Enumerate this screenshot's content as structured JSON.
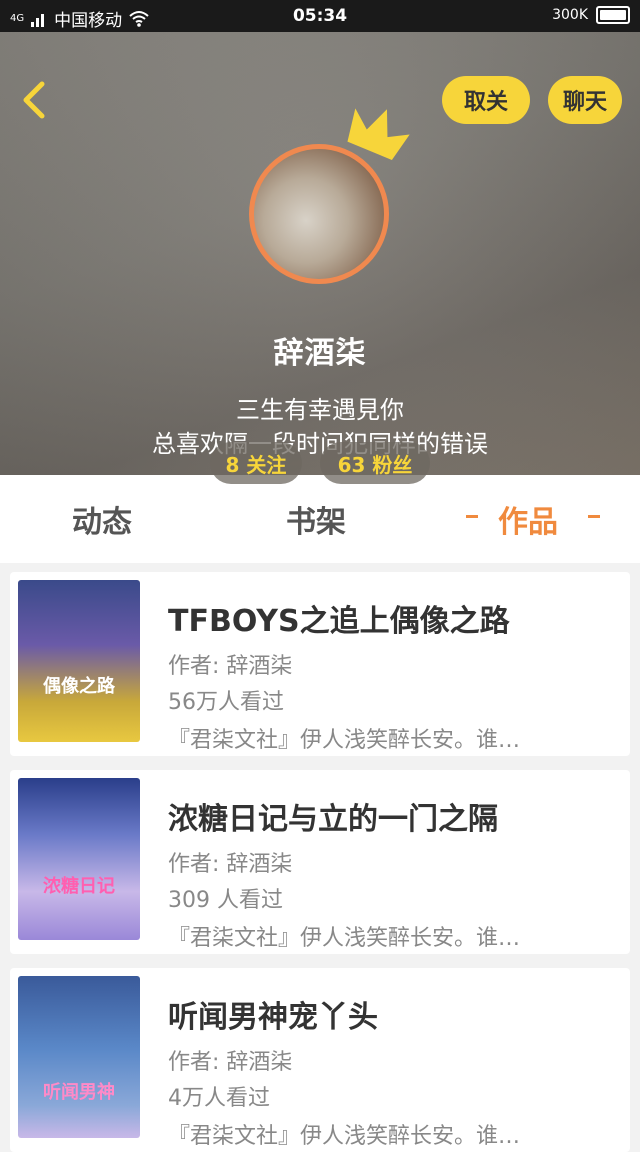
{
  "status_bar": {
    "carrier": "中国移动",
    "signal": "4G",
    "time": "05:34",
    "speed": "300K"
  },
  "header": {
    "unfollow_label": "取关",
    "chat_label": "聊天",
    "nickname": "辞酒柒",
    "bio_line_1": "三生有幸遇見你",
    "bio_line_2": "总喜欢隔一段时间犯同样的错误",
    "follow_stat": "8 关注",
    "fans_stat": "63 粉丝"
  },
  "tabs": [
    {
      "label": "动态"
    },
    {
      "label": "书架"
    },
    {
      "label": "作品"
    }
  ],
  "works": [
    {
      "title": "TFBOYS之追上偶像之路",
      "author": "作者: 辞酒柒",
      "views": "56万人看过",
      "desc": "『君柒文社』伊人浅笑醉长安。谁…",
      "cover_text": "偶像之路"
    },
    {
      "title": "浓糖日记与立的一门之隔",
      "author": "作者: 辞酒柒",
      "views": "309 人看过",
      "desc": "『君柒文社』伊人浅笑醉长安。谁…",
      "cover_text": "浓糖日记"
    },
    {
      "title": "听闻男神宠丫头",
      "author": "作者: 辞酒柒",
      "views": "4万人看过",
      "desc": "『君柒文社』伊人浅笑醉长安。谁…",
      "cover_text": "听闻男神"
    }
  ],
  "colors": {
    "accent": "#f7d53a",
    "tab_active": "#f08a3e",
    "avatar_border": "#f0894f"
  }
}
